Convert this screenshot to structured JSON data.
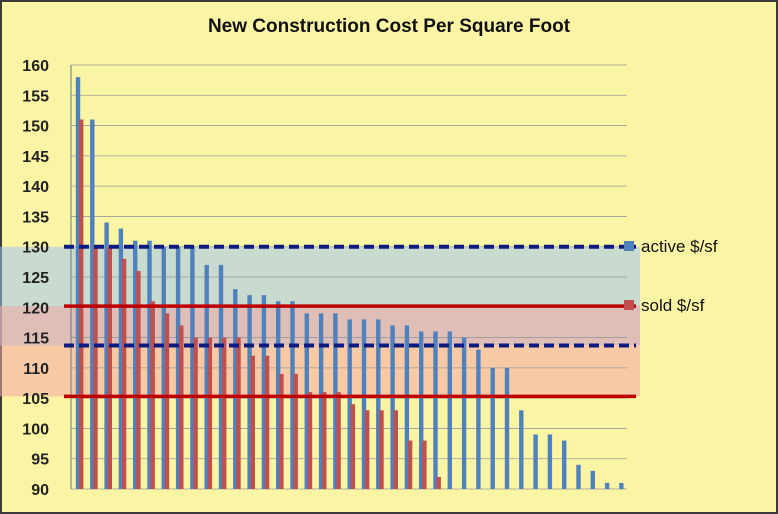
{
  "chart_data": {
    "type": "bar",
    "title": "New Construction Cost Per Square Foot",
    "xlabel": "",
    "ylabel": "",
    "ylim": [
      90,
      160
    ],
    "yticks": [
      160,
      155,
      150,
      145,
      140,
      135,
      130,
      125,
      120,
      115,
      110,
      105,
      100,
      95,
      90
    ],
    "grid": true,
    "legend_position": "right",
    "series": [
      {
        "name": "active $/sf",
        "color": "#4f81bd",
        "values": [
          158,
          151,
          134,
          133,
          131,
          131,
          130,
          130,
          130,
          127,
          127,
          123,
          122,
          122,
          121,
          121,
          119,
          119,
          119,
          118,
          118,
          118,
          117,
          117,
          116,
          116,
          116,
          115,
          113,
          110,
          110,
          103,
          99,
          99,
          98,
          94,
          93,
          91,
          91
        ]
      },
      {
        "name": "sold $/sf",
        "color": "#c0504d",
        "values": [
          151,
          130,
          130,
          128,
          126,
          121,
          119,
          117,
          115,
          115,
          115,
          115,
          112,
          112,
          109,
          109,
          106,
          106,
          106,
          104,
          103,
          103,
          103,
          98,
          98,
          92
        ]
      }
    ],
    "reference_lines": [
      {
        "value": 130,
        "style": "dashed",
        "color": "#0d1a80"
      },
      {
        "value": 113.7,
        "style": "dashed",
        "color": "#0d1a80"
      },
      {
        "value": 120.2,
        "style": "solid",
        "color": "#c00000"
      },
      {
        "value": 105.3,
        "style": "solid",
        "color": "#c00000"
      }
    ],
    "bands": [
      {
        "from": 113.7,
        "to": 130,
        "color": "#9fc5f0"
      },
      {
        "from": 105.3,
        "to": 120.2,
        "color": "#f4a6a6"
      }
    ]
  }
}
